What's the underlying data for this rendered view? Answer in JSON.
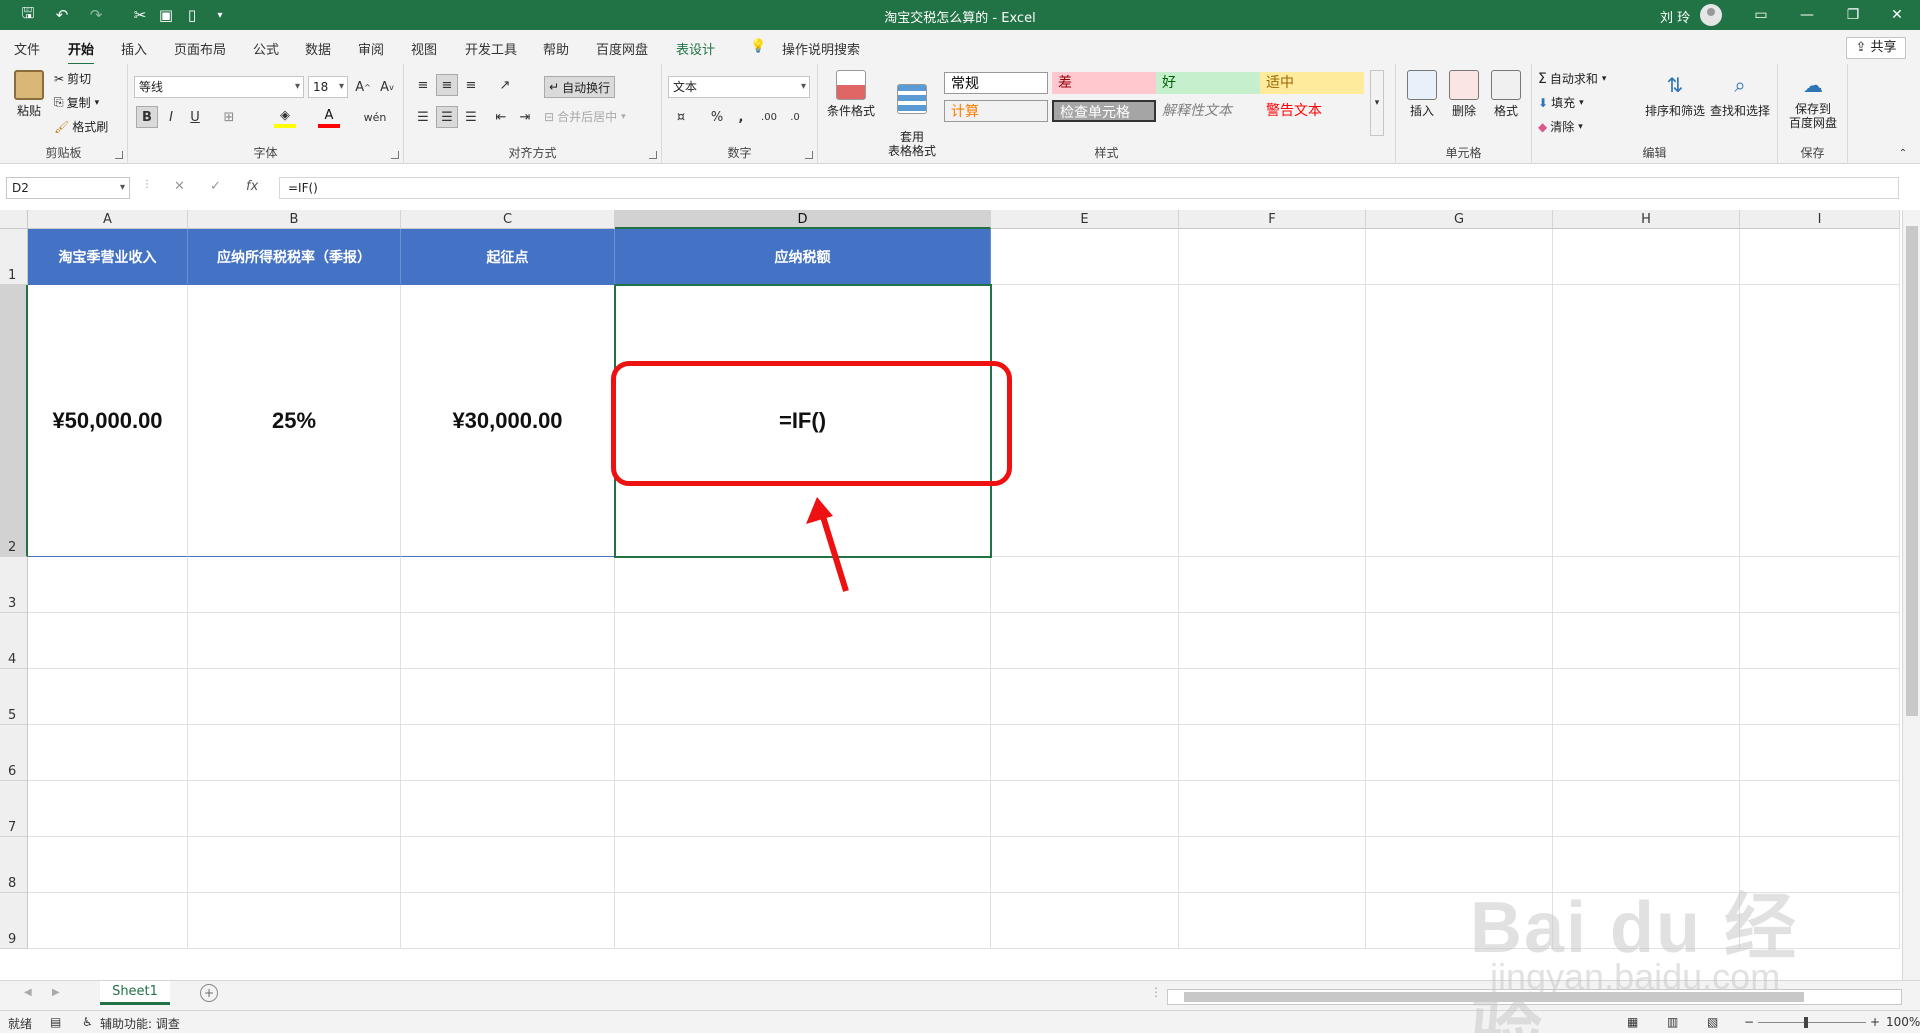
{
  "window": {
    "title": "淘宝交税怎么算的 - Excel",
    "user": "刘 玲"
  },
  "tabs": [
    "文件",
    "开始",
    "插入",
    "页面布局",
    "公式",
    "数据",
    "审阅",
    "视图",
    "开发工具",
    "帮助",
    "百度网盘",
    "表设计",
    "操作说明搜索"
  ],
  "share_label": "共享",
  "ribbon": {
    "clipboard": {
      "label": "剪贴板",
      "paste": "粘贴",
      "cut": "剪切",
      "copy": "复制",
      "format_painter": "格式刷"
    },
    "font": {
      "label": "字体",
      "name": "等线",
      "size": "18"
    },
    "alignment": {
      "label": "对齐方式",
      "wrap": "自动换行",
      "merge": "合并后居中"
    },
    "number": {
      "label": "数字",
      "format": "文本"
    },
    "styles": {
      "label": "样式",
      "conditional": "条件格式",
      "table_format": "套用\n表格格式",
      "items": [
        {
          "text": "常规",
          "bg": "#ffffff",
          "color": "#000000"
        },
        {
          "text": "差",
          "bg": "#ffc7ce",
          "color": "#9c0006"
        },
        {
          "text": "好",
          "bg": "#c6efce",
          "color": "#006100"
        },
        {
          "text": "适中",
          "bg": "#ffeb9c",
          "color": "#9c6500"
        },
        {
          "text": "计算",
          "bg": "#f2f2f2",
          "color": "#fa7d00"
        },
        {
          "text": "检查单元格",
          "bg": "#a5a5a5",
          "color": "#ffffff"
        },
        {
          "text": "解释性文本",
          "bg": "#f3f3f3",
          "color": "#7f7f7f"
        },
        {
          "text": "警告文本",
          "bg": "#f3f3f3",
          "color": "#ff0000"
        }
      ]
    },
    "cells": {
      "label": "单元格",
      "insert": "插入",
      "delete": "删除",
      "format": "格式"
    },
    "editing": {
      "label": "编辑",
      "autosum": "自动求和",
      "fill": "填充",
      "clear": "清除",
      "sort": "排序和筛选",
      "find": "查找和选择"
    },
    "save": {
      "label": "保存",
      "to_baidu": "保存到\n百度网盘"
    }
  },
  "formula_bar": {
    "name_box": "D2",
    "formula": "=IF()"
  },
  "sheet": {
    "columns": [
      "A",
      "B",
      "C",
      "D",
      "E",
      "F",
      "G",
      "H",
      "I"
    ],
    "rows": [
      "1",
      "2",
      "3",
      "4",
      "5",
      "6",
      "7",
      "8",
      "9"
    ],
    "headers": [
      "淘宝季营业收入",
      "应纳所得税税率（季报）",
      "起征点",
      "应纳税额"
    ],
    "values": [
      "¥50,000.00",
      "25%",
      "¥30,000.00",
      "=IF()"
    ],
    "active_cell": "D2",
    "tab": "Sheet1"
  },
  "status": {
    "ready": "就绪",
    "accessibility": "辅助功能: 调查",
    "zoom": "100%"
  },
  "watermark": {
    "brand": "Bai du 经验",
    "url": "jingyan.baidu.com"
  }
}
